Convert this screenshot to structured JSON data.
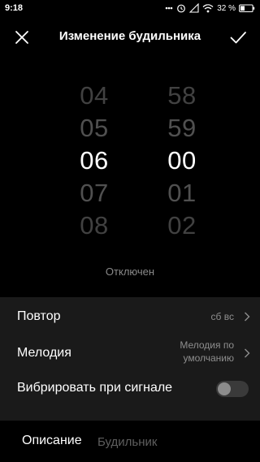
{
  "status_bar": {
    "time": "9:18",
    "battery": "32 %"
  },
  "header": {
    "title": "Изменение будильника"
  },
  "hours": {
    "items": [
      "04",
      "05",
      "06",
      "07",
      "08"
    ],
    "selected": "06"
  },
  "minutes": {
    "items": [
      "58",
      "59",
      "00",
      "01",
      "02"
    ],
    "selected": "00"
  },
  "alarm_state": "Отключен",
  "settings": {
    "repeat": {
      "label": "Повтор",
      "value": "сб вс"
    },
    "melody": {
      "label": "Мелодия",
      "value_line1": "Мелодия по",
      "value_line2": "умолчанию"
    },
    "vibrate": {
      "label": "Вибрировать при сигнале",
      "enabled": false
    }
  },
  "description": {
    "label": "Описание",
    "placeholder": "Будильник"
  }
}
